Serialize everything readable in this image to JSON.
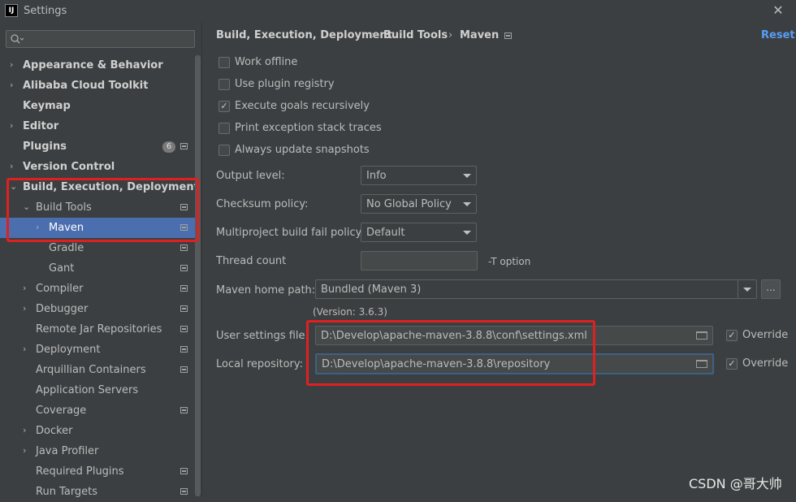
{
  "window": {
    "title": "Settings",
    "app_icon_text": "IJ",
    "close_glyph": "✕"
  },
  "sidebar": {
    "search_placeholder": "",
    "items": [
      {
        "label": "Appearance & Behavior",
        "bold": true,
        "arrow": "›"
      },
      {
        "label": "Alibaba Cloud Toolkit",
        "bold": true,
        "arrow": "›"
      },
      {
        "label": "Keymap",
        "bold": true,
        "arrow": ""
      },
      {
        "label": "Editor",
        "bold": true,
        "arrow": "›"
      },
      {
        "label": "Plugins",
        "bold": true,
        "arrow": "",
        "badge": "6"
      },
      {
        "label": "Version Control",
        "bold": true,
        "arrow": "›"
      },
      {
        "label": "Build, Execution, Deployment",
        "bold": true,
        "arrow": "⌄"
      },
      {
        "label": "Build Tools",
        "bold": false,
        "arrow": "⌄"
      },
      {
        "label": "Maven",
        "bold": false,
        "arrow": "›",
        "selected": true
      },
      {
        "label": "Gradle",
        "bold": false,
        "arrow": ""
      },
      {
        "label": "Gant",
        "bold": false,
        "arrow": ""
      },
      {
        "label": "Compiler",
        "bold": false,
        "arrow": "›"
      },
      {
        "label": "Debugger",
        "bold": false,
        "arrow": "›"
      },
      {
        "label": "Remote Jar Repositories",
        "bold": false,
        "arrow": ""
      },
      {
        "label": "Deployment",
        "bold": false,
        "arrow": "›"
      },
      {
        "label": "Arquillian Containers",
        "bold": false,
        "arrow": ""
      },
      {
        "label": "Application Servers",
        "bold": false,
        "arrow": ""
      },
      {
        "label": "Coverage",
        "bold": false,
        "arrow": ""
      },
      {
        "label": "Docker",
        "bold": false,
        "arrow": "›"
      },
      {
        "label": "Java Profiler",
        "bold": false,
        "arrow": "›"
      },
      {
        "label": "Required Plugins",
        "bold": false,
        "arrow": ""
      },
      {
        "label": "Run Targets",
        "bold": false,
        "arrow": ""
      }
    ]
  },
  "breadcrumb": {
    "part1": "Build, Execution, Deployment",
    "sep": "›",
    "part2": "Build Tools",
    "part3": "Maven"
  },
  "reset_label": "Reset",
  "checkboxes": [
    {
      "label": "Work offline",
      "checked": false
    },
    {
      "label": "Use plugin registry",
      "checked": false
    },
    {
      "label": "Execute goals recursively",
      "checked": true
    },
    {
      "label": "Print exception stack traces",
      "checked": false
    },
    {
      "label": "Always update snapshots",
      "checked": false
    }
  ],
  "check_glyph": "✓",
  "fields": {
    "output_level": {
      "label": "Output level:",
      "value": "Info"
    },
    "checksum_policy": {
      "label": "Checksum policy:",
      "value": "No Global Policy"
    },
    "multiproject_fail": {
      "label": "Multiproject build fail policy:",
      "value": "Default"
    },
    "thread_count": {
      "label": "Thread count",
      "value": "",
      "hint": "-T option"
    },
    "maven_home": {
      "label": "Maven home path:",
      "value": "Bundled (Maven 3)",
      "version": "(Version: 3.6.3)",
      "browse": "..."
    },
    "user_settings": {
      "label": "User settings file:",
      "value": "D:\\Develop\\apache-maven-3.8.8\\conf\\settings.xml",
      "override_label": "Override",
      "override_checked": true
    },
    "local_repo": {
      "label": "Local repository:",
      "value": "D:\\Develop\\apache-maven-3.8.8\\repository",
      "override_label": "Override",
      "override_checked": true
    }
  },
  "watermark": "CSDN @哥大帅",
  "colors": {
    "accent": "#589df6",
    "selection": "#4b6eaf",
    "annotation_red": "#e02020",
    "background": "#3c3f41"
  }
}
